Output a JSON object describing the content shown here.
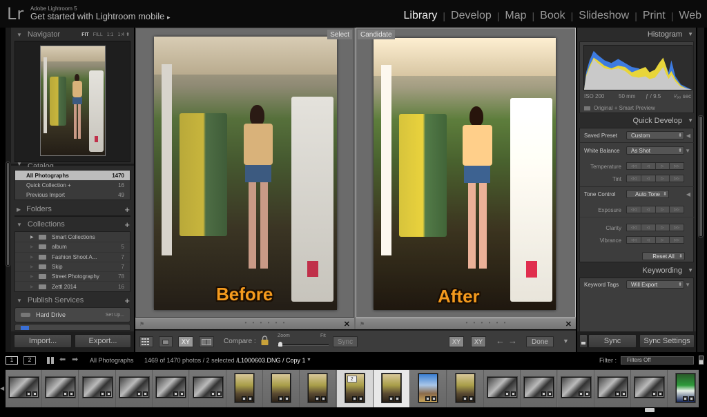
{
  "app": {
    "logo": "Lr",
    "name": "Adobe Lightroom 5",
    "mobile_link": "Get started with Lightroom mobile",
    "mobile_link_arrow": "▸"
  },
  "modules": [
    {
      "label": "Library",
      "active": true
    },
    {
      "label": "Develop",
      "active": false
    },
    {
      "label": "Map",
      "active": false
    },
    {
      "label": "Book",
      "active": false
    },
    {
      "label": "Slideshow",
      "active": false
    },
    {
      "label": "Print",
      "active": false
    },
    {
      "label": "Web",
      "active": false
    }
  ],
  "left_panel": {
    "navigator": {
      "title": "Navigator",
      "opts": [
        "FIT",
        "FILL",
        "1:1",
        "1:4"
      ],
      "active_opt": "FIT"
    },
    "catalog": {
      "title": "Catalog",
      "items": [
        {
          "label": "All Photographs",
          "count": "1470",
          "selected": true
        },
        {
          "label": "Quick Collection +",
          "count": "16",
          "selected": false
        },
        {
          "label": "Previous Import",
          "count": "49",
          "selected": false
        }
      ]
    },
    "folders": {
      "title": "Folders"
    },
    "collections": {
      "title": "Collections",
      "items": [
        {
          "label": "Smart Collections",
          "count": "",
          "type": "smart"
        },
        {
          "label": "album",
          "count": "5",
          "type": "folder"
        },
        {
          "label": "Fashion Shoot A...",
          "count": "7",
          "type": "folder"
        },
        {
          "label": "Skip",
          "count": "7",
          "type": "folder"
        },
        {
          "label": "Street Photography",
          "count": "78",
          "type": "folder"
        },
        {
          "label": "Zettl 2014",
          "count": "16",
          "type": "folder"
        }
      ]
    },
    "publish_services": {
      "title": "Publish Services",
      "items": [
        {
          "label": "Hard Drive",
          "action": "Set Up..."
        }
      ]
    },
    "import_label": "Import...",
    "export_label": "Export..."
  },
  "compare": {
    "select_label": "Select",
    "candidate_label": "Candidate",
    "before_text": "Before",
    "after_text": "After",
    "flag_glyph": "⚑",
    "close_glyph": "✕",
    "dots": "• • • • • •"
  },
  "toolbar": {
    "grid_view": "grid-view",
    "loupe_view": "loupe-view",
    "compare_view_label": "XY",
    "survey_view": "survey-view",
    "compare_label": "Compare :",
    "zoom_label": "Zoom",
    "fit_label": "Fit",
    "zoom_value": 0,
    "sync_label": "Sync",
    "swap_label": "XY",
    "make_select_label": "XY",
    "prev_arrow": "←",
    "next_arrow": "→",
    "done_label": "Done",
    "menu_arrow": "▼"
  },
  "right_panel": {
    "histogram": {
      "title": "Histogram",
      "iso": "ISO 200",
      "focal": "50 mm",
      "aperture": "ƒ / 9.5",
      "shutter": "¹⁄₉₀ sec",
      "preview_status": "Original + Smart Preview"
    },
    "quick_develop": {
      "title": "Quick Develop",
      "saved_preset_label": "Saved Preset",
      "saved_preset_value": "Custom",
      "white_balance_label": "White Balance",
      "white_balance_value": "As Shot",
      "temperature_label": "Temperature",
      "tint_label": "Tint",
      "tone_control_label": "Tone Control",
      "auto_tone_label": "Auto Tone",
      "exposure_label": "Exposure",
      "clarity_label": "Clarity",
      "vibrance_label": "Vibrance",
      "reset_all_label": "Reset All",
      "step_glyphs": [
        "◁◁",
        "◁",
        "▷",
        "▷▷"
      ]
    },
    "keywording": {
      "title": "Keywording",
      "keyword_tags_label": "Keyword Tags",
      "keyword_tags_value": "Will Export"
    },
    "sync_label": "Sync",
    "sync_settings_label": "Sync Settings"
  },
  "filmstrip_bar": {
    "view1": "1",
    "view2": "2",
    "source": "All Photographs",
    "status": "1469 of 1470 photos / 2 selected /",
    "selected_file": "L1000603.DNG / Copy 1",
    "filter_label": "Filter :",
    "filter_value": "Filters Off"
  },
  "filmstrip": {
    "thumbs": [
      {
        "orient": "land",
        "tone": "bw"
      },
      {
        "orient": "land",
        "tone": "bw"
      },
      {
        "orient": "land",
        "tone": "bw"
      },
      {
        "orient": "land",
        "tone": "bw"
      },
      {
        "orient": "land",
        "tone": "bw"
      },
      {
        "orient": "land",
        "tone": "bw"
      },
      {
        "orient": "port",
        "tone": "color"
      },
      {
        "orient": "port",
        "tone": "color"
      },
      {
        "orient": "port",
        "tone": "color"
      },
      {
        "orient": "port",
        "tone": "color",
        "selected": "primary",
        "badge": "2"
      },
      {
        "orient": "port",
        "tone": "color",
        "selected": "secondary"
      },
      {
        "orient": "port",
        "tone": "sky"
      },
      {
        "orient": "port",
        "tone": "color"
      },
      {
        "orient": "land",
        "tone": "bw"
      },
      {
        "orient": "land",
        "tone": "bw"
      },
      {
        "orient": "land",
        "tone": "bw"
      },
      {
        "orient": "land",
        "tone": "bw"
      },
      {
        "orient": "land",
        "tone": "bw"
      },
      {
        "orient": "port",
        "tone": "green"
      }
    ]
  }
}
